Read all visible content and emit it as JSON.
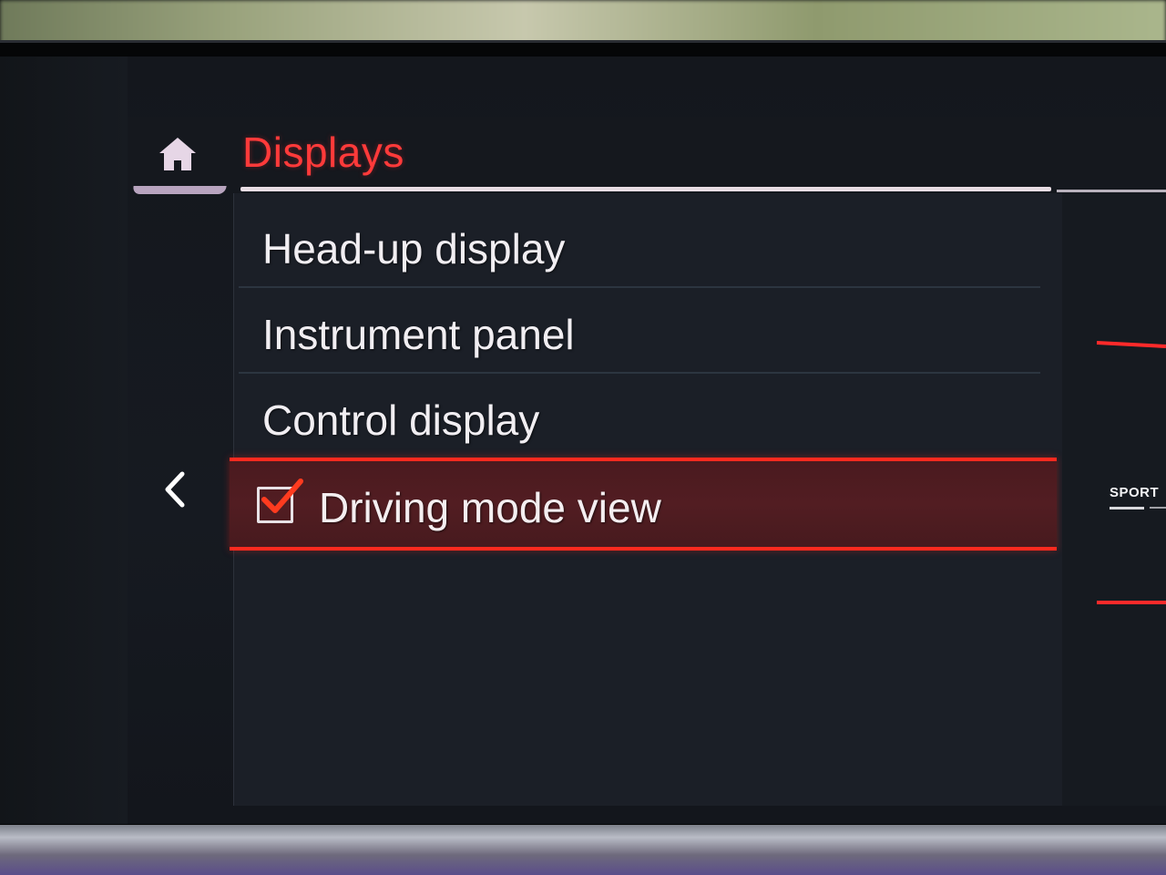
{
  "header": {
    "title": "Displays",
    "home_icon": "home-icon"
  },
  "navigation": {
    "back_icon": "chevron-left-icon"
  },
  "menu": {
    "items": [
      {
        "label": "Head-up display"
      },
      {
        "label": "Instrument panel"
      },
      {
        "label": "Control display"
      },
      {
        "label": "Driving mode view",
        "checked": true,
        "selected": true
      }
    ]
  },
  "preview": {
    "mode_label": "SPORT"
  },
  "colors": {
    "accent": "#ff2a1f",
    "title": "#ff3a3a",
    "selected_bg": "#4f1c21",
    "panel_bg": "#1b1f27",
    "text": "#f1eef2"
  }
}
